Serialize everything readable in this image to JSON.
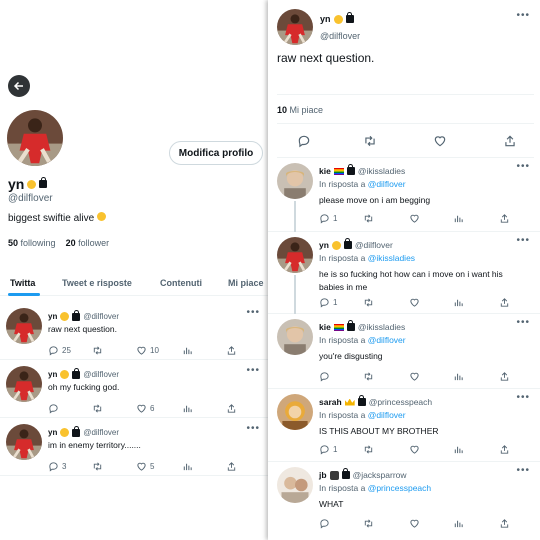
{
  "profile": {
    "name": "yn",
    "handle": "@dilflover",
    "bio": "biggest swiftie alive",
    "edit_button": "Modifica profilo",
    "following_count": "50",
    "following_label": "following",
    "followers_count": "20",
    "followers_label": "follower",
    "tabs": [
      "Twitta",
      "Tweet e risposte",
      "Contenuti",
      "Mi piace"
    ],
    "tweets": [
      {
        "name": "yn",
        "handle": "@dilflover",
        "text": "raw next question.",
        "replies": "25",
        "likes": "10"
      },
      {
        "name": "yn",
        "handle": "@dilflover",
        "text": "oh my fucking god.",
        "replies": "",
        "likes": "6"
      },
      {
        "name": "yn",
        "handle": "@dilflover",
        "text": "im in enemy territory.......",
        "replies": "3",
        "likes": "5"
      }
    ]
  },
  "thread": {
    "main": {
      "name": "yn",
      "handle": "@dilflover",
      "text": "raw next question.",
      "likes_count": "10",
      "likes_label": "Mi piace"
    },
    "in_reply_label": "In risposta a",
    "replies": [
      {
        "name": "kie",
        "handle": "@ikissladies",
        "reply_to": "@dilflover",
        "text": "please move on i am begging",
        "replies": "1",
        "emoji": "flag"
      },
      {
        "name": "yn",
        "handle": "@dilflover",
        "reply_to": "@ikissladies",
        "text": "he is so fucking hot how can i move on i want his babies in me",
        "replies": "1",
        "emoji": "face"
      },
      {
        "name": "kie",
        "handle": "@ikissladies",
        "reply_to": "@dilflover",
        "text": "you're disgusting",
        "replies": "",
        "emoji": "flag"
      },
      {
        "name": "sarah",
        "handle": "@princesspeach",
        "reply_to": "@dilflover",
        "text": "IS THIS ABOUT MY BROTHER",
        "replies": "1",
        "emoji": "crown"
      },
      {
        "name": "jb",
        "handle": "@jacksparrow",
        "reply_to": "@princesspeach",
        "text": "WHAT",
        "replies": "",
        "emoji": "small"
      }
    ]
  },
  "colors": {
    "accent": "#1d9bf0",
    "text": "#0f1419",
    "muted": "#536471",
    "border": "#eff3f4"
  },
  "icons": [
    "back-arrow-icon",
    "reply-icon",
    "retweet-icon",
    "like-icon",
    "stats-icon",
    "share-icon",
    "lock-icon",
    "more-icon"
  ]
}
